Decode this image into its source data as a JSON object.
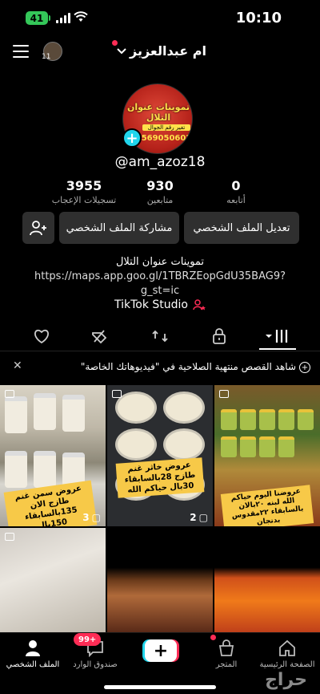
{
  "status_bar": {
    "time": "10:10",
    "battery": "41"
  },
  "header": {
    "username": "ام عبدالعزيز",
    "mini_count": "11"
  },
  "profile": {
    "avatar": {
      "shop_text": "تموينات عنوان التلال",
      "tag_text": "تغير رقم الجوال",
      "phone_text": "569050602"
    },
    "handle": "@am_azoz18",
    "stats": [
      {
        "value": "0",
        "label": "أتابعه"
      },
      {
        "value": "930",
        "label": "متابعين"
      },
      {
        "value": "3955",
        "label": "تسجيلات الإعجاب"
      }
    ],
    "buttons": {
      "edit": "تعديل الملف الشخصي",
      "share": "مشاركة الملف الشخصي"
    },
    "bio_line1": "تموينات عنوان التلال",
    "bio_line2": "https://maps.app.goo.gl/1TBRZEopGdU35BAG9?",
    "bio_line3": "g_st=ic",
    "studio": "TikTok Studio"
  },
  "notice": {
    "text": "شاهد القصص منتهية الصلاحية في \"فيديوهاتك الخاصة\""
  },
  "grid": [
    {
      "caption": "عروض سمن غنم طازج الان 135بالسابقاء 150بال",
      "count": "3"
    },
    {
      "caption": "عروض خاثر غنم طازج 28بالسابقاء 30بال حياكم الله",
      "count": "2"
    },
    {
      "caption": "عروضنا اليوم حياكم الله لبنه ٢٠بالان بالسابقاء ٢٢مقدوس بدنجان",
      "count": ""
    },
    {
      "caption": "",
      "count": ""
    },
    {
      "caption": "",
      "count": ""
    },
    {
      "caption": "",
      "count": ""
    }
  ],
  "bottom_nav": {
    "home": "الصفحة الرئيسية",
    "shop": "المتجر",
    "inbox": "صندوق الوارد",
    "inbox_badge": "99+",
    "profile": "الملف الشخصي"
  },
  "watermark": "حراج",
  "colors": {
    "accent_red": "#fe2c55",
    "accent_cyan": "#20d5ec",
    "background": "#000000"
  }
}
